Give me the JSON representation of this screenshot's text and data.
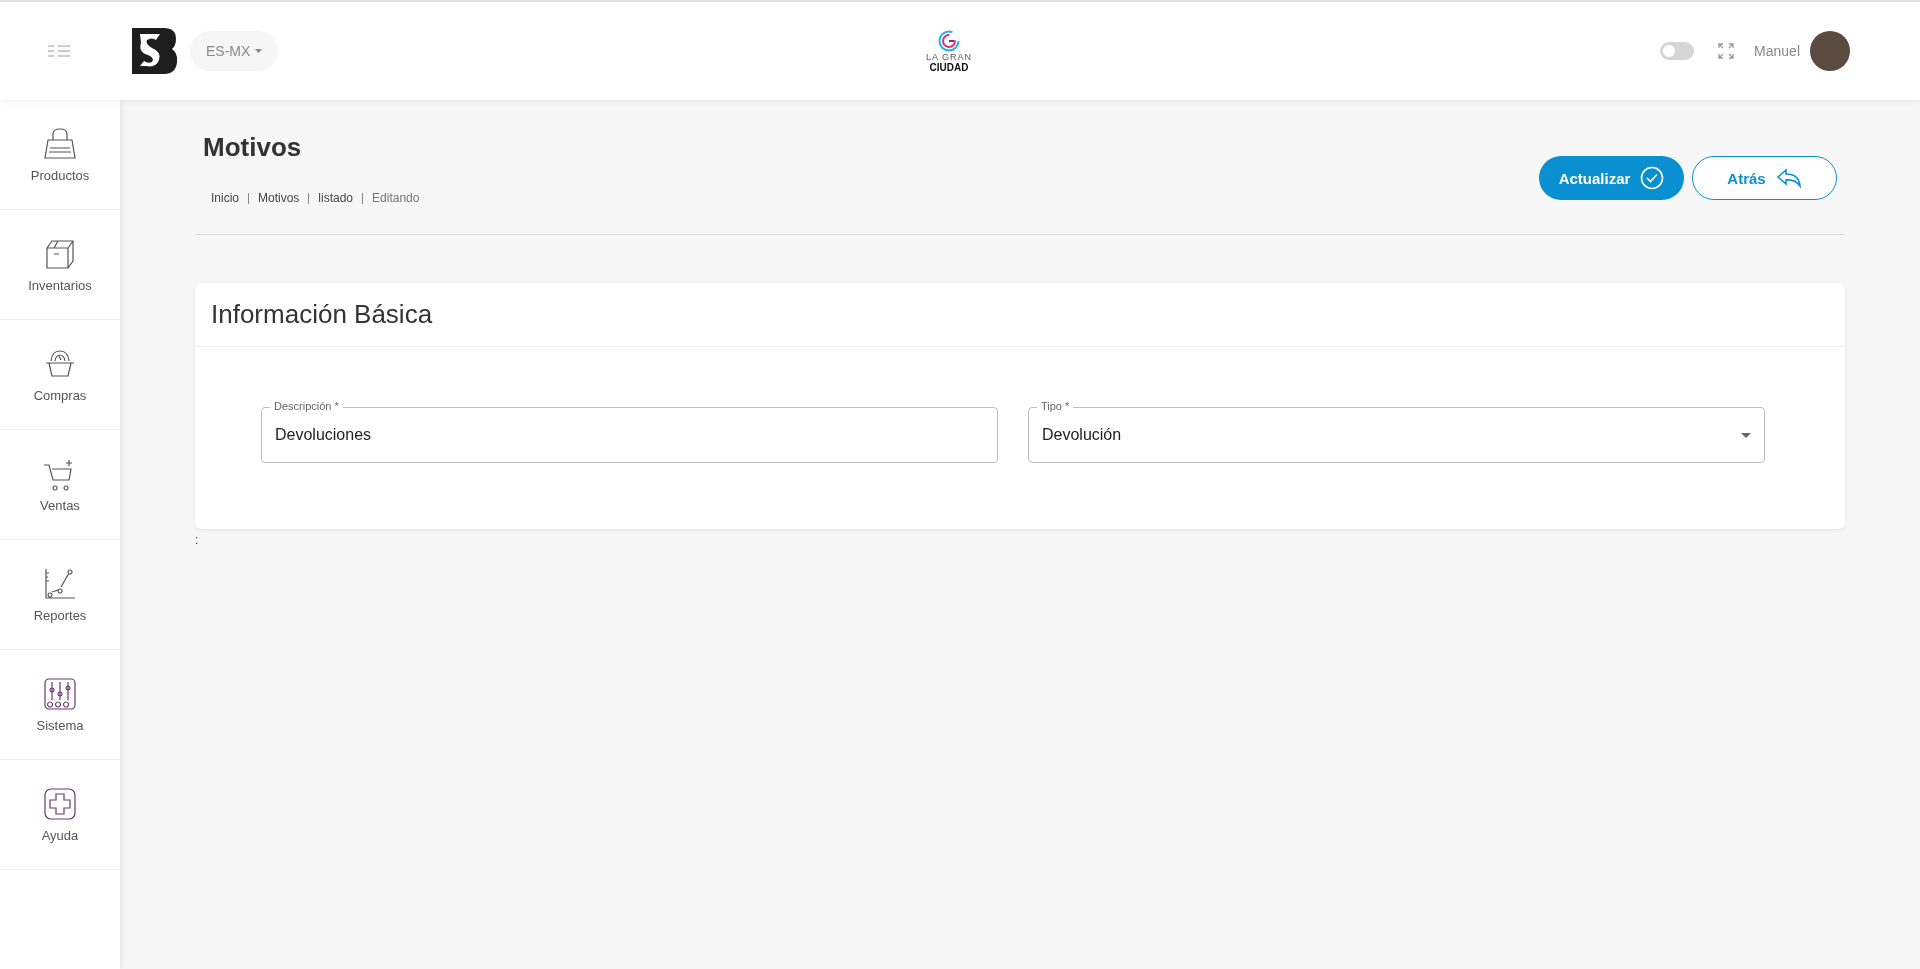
{
  "header": {
    "language": "ES-MX",
    "logo_text": [
      "LA GRAN",
      "CIUDAD"
    ],
    "dark_mode": {
      "on": false
    },
    "user_name": "Manuel"
  },
  "sidebar": {
    "items": [
      {
        "label": "Productos",
        "kind": "bag"
      },
      {
        "label": "Inventarios",
        "kind": "box"
      },
      {
        "label": "Compras",
        "kind": "basket"
      },
      {
        "label": "Ventas",
        "kind": "cart"
      },
      {
        "label": "Reportes",
        "kind": "chart"
      },
      {
        "label": "Sistema",
        "kind": "sliders"
      },
      {
        "label": "Ayuda",
        "kind": "help"
      }
    ]
  },
  "page": {
    "title": "Motivos",
    "breadcrumbs": [
      "Inicio",
      "Motivos",
      "listado",
      "Editando"
    ],
    "actions": [
      {
        "label": "Actualizar",
        "kind": "primary"
      },
      {
        "label": "Atrás",
        "kind": "back"
      }
    ]
  },
  "card": {
    "title": "Información Básica",
    "fields": [
      {
        "label": "Descripción *",
        "value": "Devoluciones",
        "kind": "text"
      },
      {
        "label": "Tipo *",
        "value": "Devolución",
        "kind": "select"
      }
    ]
  },
  "footer_mark": ":"
}
